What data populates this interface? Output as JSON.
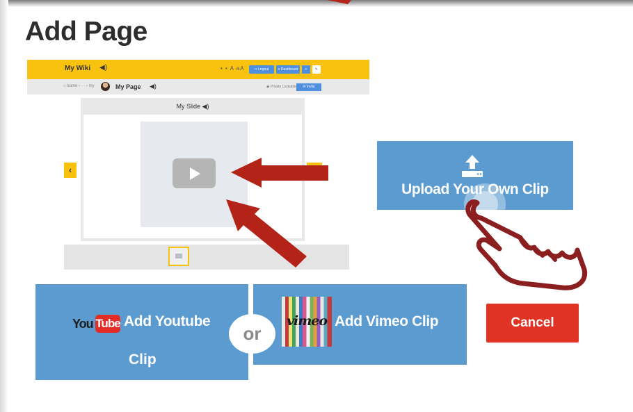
{
  "page": {
    "title": "Add Page"
  },
  "preview": {
    "wiki_title": "My Wiki",
    "speaker_glyph": "◀)",
    "header_dots": "• • A aA",
    "logout": "↪ Logout",
    "dashboard": "≡ Dashboard",
    "plus": "+",
    "pencil": "✎",
    "crumbs": "⌂  home ›  · ·  › my",
    "page_title": "My Page",
    "private": "◉ Private Lockable",
    "invite": "✉ Invite",
    "slide_title": "My Slide",
    "nav_left": "‹",
    "nav_right": "›"
  },
  "actions": {
    "upload_label": "Upload Your Own Clip",
    "youtube_logo_you": "You",
    "youtube_logo_tube": "Tube",
    "youtube_label": "Add Youtube",
    "youtube_label_2": "Clip",
    "vimeo_logo": "vimeo",
    "vimeo_label": "Add Vimeo Clip",
    "or": "or",
    "cancel": "Cancel"
  },
  "colors": {
    "accent_blue": "#5b9bd0",
    "wiki_yellow": "#f8c20f",
    "cancel_red": "#e03326",
    "arrow_red": "#b42318"
  },
  "icons": [
    "upload-icon",
    "play-icon",
    "speaker-icon",
    "pointing-hand-icon",
    "red-arrow-icon"
  ]
}
